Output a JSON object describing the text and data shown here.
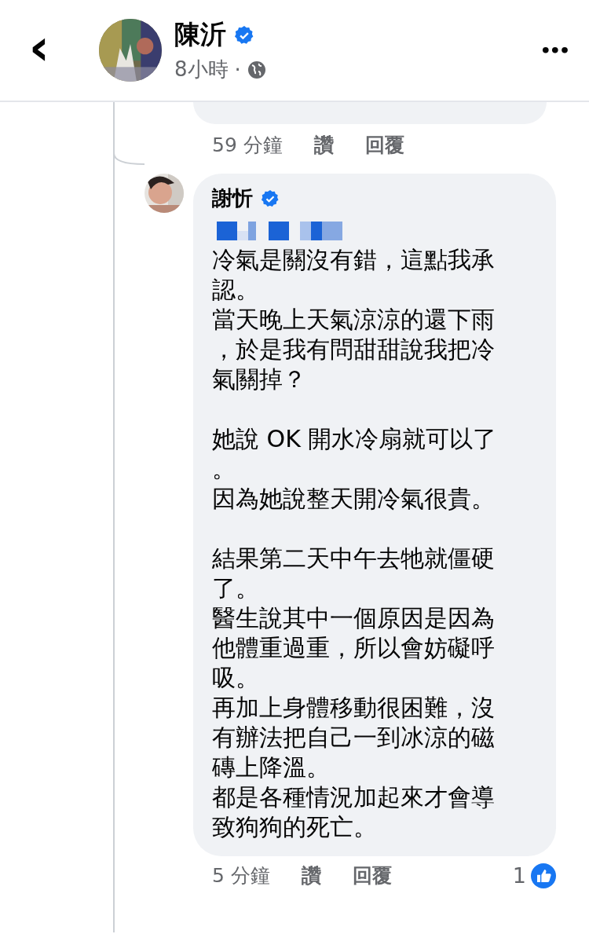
{
  "header": {
    "back": "‹",
    "author": "陳沂",
    "verified": true,
    "time": "8小時",
    "separator": "·",
    "more": "•••"
  },
  "previous_reply": {
    "time": "59 分鐘",
    "like": "讚",
    "reply": "回覆"
  },
  "comment": {
    "author": "謝忻",
    "verified": true,
    "mention_redacted": true,
    "paragraphs": [
      [
        "冷氣是關沒有錯，這點我承認。",
        "當天晚上天氣涼涼的還下雨，於是我有問甜甜說我把冷氣關掉？"
      ],
      [
        "她說 OK 開水冷扇就可以了。",
        "因為她說整天開冷氣很貴。"
      ],
      [
        "結果第二天中午去牠就僵硬了。",
        "醫生說其中一個原因是因為他體重過重，所以會妨礙呼吸。",
        "再加上身體移動很困難，沒有辦法把自己一到冰涼的磁磚上降溫。",
        "都是各種情況加起來才會導致狗狗的死亡。"
      ]
    ],
    "time": "5 分鐘",
    "like": "讚",
    "reply": "回覆",
    "reaction_count": "1"
  }
}
